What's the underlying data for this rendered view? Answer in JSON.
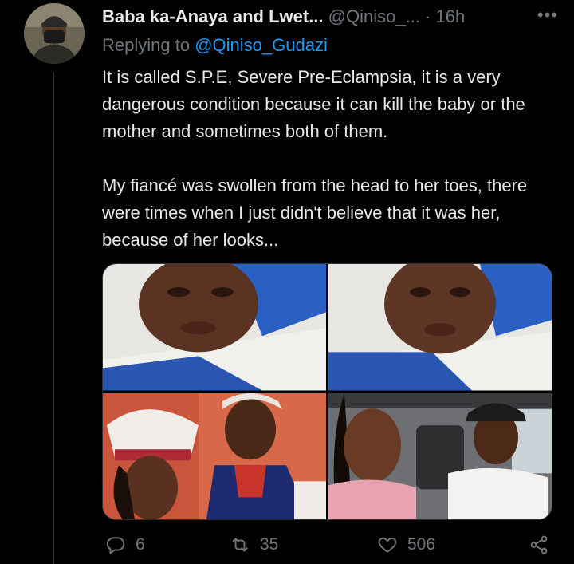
{
  "tweet": {
    "display_name": "Baba ka-Anaya and Lwet...",
    "handle": "@Qiniso_...",
    "separator": "·",
    "time": "16h",
    "more_icon": "more-dots-icon",
    "replying_prefix": "Replying to",
    "replying_to": "@Qiniso_Gudazi",
    "paragraphs": [
      "It is called S.P.E, Severe Pre-Eclampsia, it is a very dangerous condition because it can kill the baby or the mother and sometimes both of them.",
      "My fiancé was swollen from the head to her toes, there were times when I just didn't believe that it was her, because of her looks..."
    ]
  },
  "media": {
    "photos": [
      {
        "icon": "photo-woman-in-hospital-bed-1"
      },
      {
        "icon": "photo-woman-in-hospital-bed-2"
      },
      {
        "icon": "photo-couple-traditional-attire"
      },
      {
        "icon": "photo-couple-in-car"
      }
    ]
  },
  "actions": {
    "reply_count": "6",
    "retweet_count": "35",
    "like_count": "506",
    "icons": [
      "reply-icon",
      "retweet-icon",
      "like-icon",
      "share-icon"
    ]
  },
  "colors": {
    "background": "#000000",
    "text": "#e7e9ea",
    "muted": "#71767b",
    "accent": "#1d9bf0"
  }
}
